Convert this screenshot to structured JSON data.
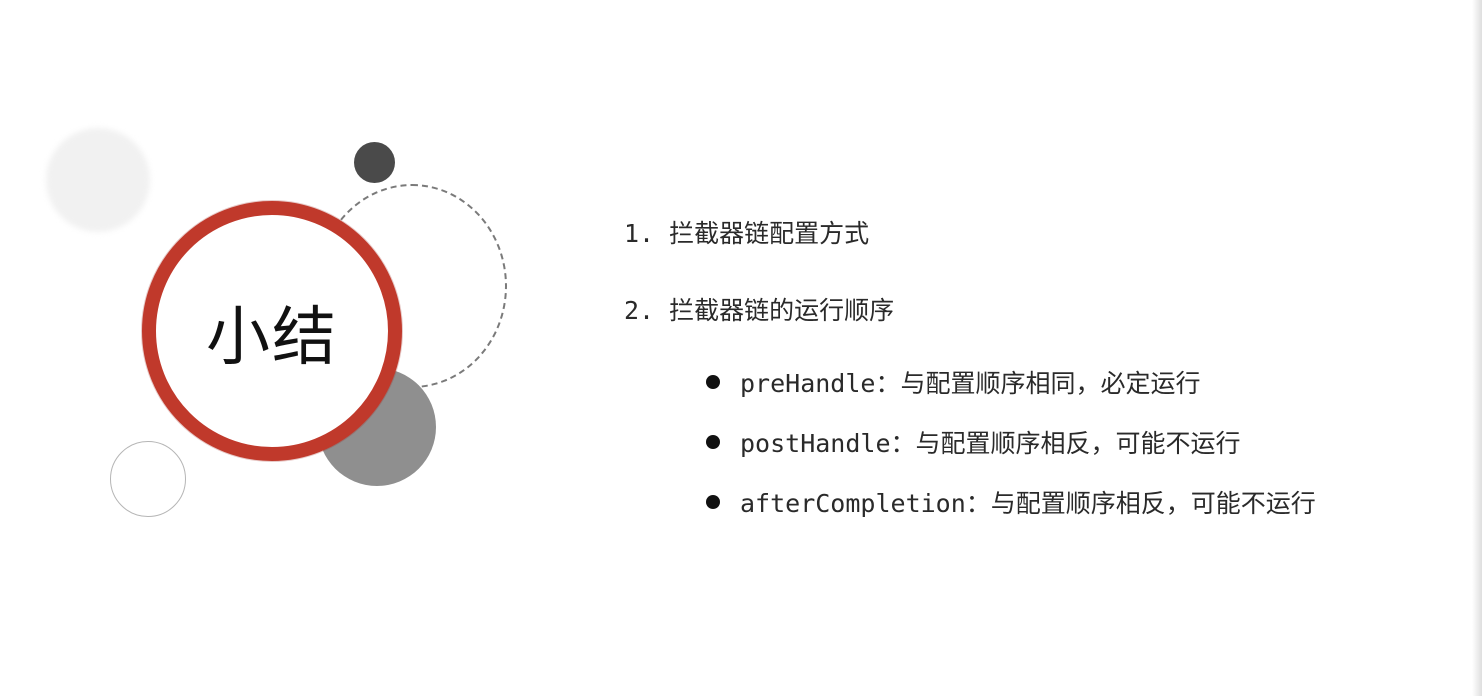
{
  "slide": {
    "title": "小结",
    "points": [
      {
        "label": "1. 拦截器链配置方式"
      },
      {
        "label": "2. 拦截器链的运行顺序"
      }
    ],
    "sub_points": [
      {
        "label": "preHandle：与配置顺序相同，必定运行"
      },
      {
        "label": "postHandle：与配置顺序相反，可能不运行"
      },
      {
        "label": "afterCompletion：与配置顺序相反，可能不运行"
      }
    ]
  },
  "colors": {
    "ring": "#c0392b",
    "dark_dot": "#4a4a4a",
    "grey_disc": "#8f8f8f"
  }
}
